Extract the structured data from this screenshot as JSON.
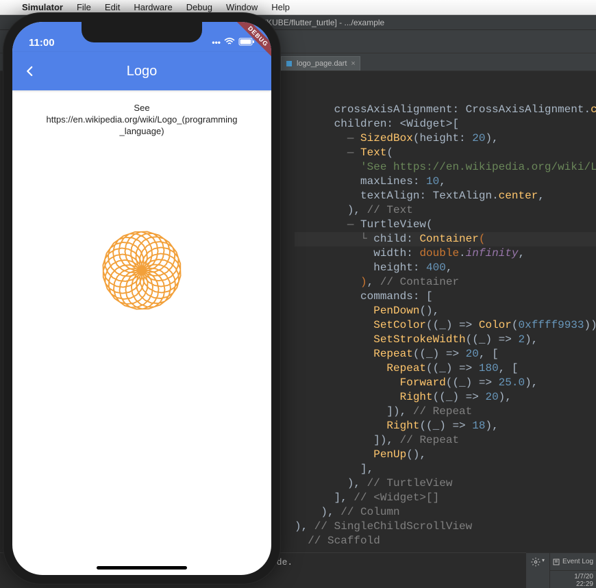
{
  "menubar": {
    "apple_icon": "",
    "items": [
      "Simulator",
      "File",
      "Edit",
      "Hardware",
      "Debug",
      "Window",
      "Help"
    ]
  },
  "ide": {
    "window_title": "flutter_turtle [~/KUBE/flutter_turtle] - .../example",
    "tab": {
      "label": "logo_page.dart"
    },
    "event_log_label": "Event Log",
    "timestamp_short": "1/7/20",
    "clock": "22:29",
    "console_tail": "ode.",
    "code_lines": [
      {
        "indent": 3,
        "tokens": [
          [
            "cls",
            "crossAxisAlignment"
          ],
          [
            "pun",
            ": "
          ],
          [
            "cls",
            "CrossAxisAlignment"
          ],
          [
            "pun",
            "."
          ],
          [
            "ylw",
            "cen"
          ]
        ]
      },
      {
        "indent": 3,
        "tokens": [
          [
            "cls",
            "children"
          ],
          [
            "pun",
            ": <"
          ],
          [
            "cls",
            "Widget"
          ],
          [
            "pun",
            ">["
          ]
        ]
      },
      {
        "indent": 4,
        "guide": true,
        "tokens": [
          [
            "ylw",
            "SizedBox"
          ],
          [
            "pun",
            "("
          ],
          [
            "cls",
            "height"
          ],
          [
            "pun",
            ": "
          ],
          [
            "num",
            "20"
          ],
          [
            "pun",
            "),"
          ]
        ]
      },
      {
        "indent": 4,
        "guide": true,
        "tokens": [
          [
            "ylw",
            "Text"
          ],
          [
            "pun",
            "("
          ]
        ]
      },
      {
        "indent": 5,
        "tokens": [
          [
            "str",
            "'See https://en.wikipedia.org/wiki/Logo"
          ]
        ]
      },
      {
        "indent": 5,
        "tokens": [
          [
            "cls",
            "maxLines"
          ],
          [
            "pun",
            ": "
          ],
          [
            "num",
            "10"
          ],
          [
            "pun",
            ","
          ]
        ]
      },
      {
        "indent": 5,
        "tokens": [
          [
            "cls",
            "textAlign"
          ],
          [
            "pun",
            ": "
          ],
          [
            "cls",
            "TextAlign"
          ],
          [
            "pun",
            "."
          ],
          [
            "ylw",
            "center"
          ],
          [
            "pun",
            ","
          ]
        ]
      },
      {
        "indent": 4,
        "tokens": [
          [
            "pun",
            "),"
          ],
          [
            "cmt",
            " // Text"
          ]
        ]
      },
      {
        "indent": 4,
        "guide": true,
        "tokens": [
          [
            "cls",
            "TurtleView"
          ],
          [
            "pun",
            "("
          ]
        ]
      },
      {
        "indent": 5,
        "hl": true,
        "guide2": true,
        "tokens": [
          [
            "cls",
            "child"
          ],
          [
            "pun",
            ": "
          ],
          [
            "ylw",
            "Container"
          ],
          [
            "kw",
            "("
          ]
        ]
      },
      {
        "indent": 6,
        "tokens": [
          [
            "cls",
            "width"
          ],
          [
            "pun",
            ": "
          ],
          [
            "kw",
            "double"
          ],
          [
            "pun",
            "."
          ],
          [
            "it",
            "infinity"
          ],
          [
            "pun",
            ","
          ]
        ]
      },
      {
        "indent": 6,
        "tokens": [
          [
            "cls",
            "height"
          ],
          [
            "pun",
            ": "
          ],
          [
            "num",
            "400"
          ],
          [
            "pun",
            ","
          ]
        ]
      },
      {
        "indent": 5,
        "tokens": [
          [
            "kw",
            ")"
          ],
          [
            "pun",
            ","
          ],
          [
            "cmt",
            " // Container"
          ]
        ]
      },
      {
        "indent": 5,
        "tokens": [
          [
            "cls",
            "commands"
          ],
          [
            "pun",
            ": ["
          ]
        ]
      },
      {
        "indent": 6,
        "tokens": [
          [
            "ylw",
            "PenDown"
          ],
          [
            "pun",
            "(),"
          ]
        ]
      },
      {
        "indent": 6,
        "tokens": [
          [
            "ylw",
            "SetColor"
          ],
          [
            "pun",
            "(("
          ],
          [
            "cls",
            "_"
          ],
          [
            "pun",
            ") => "
          ],
          [
            "ylw",
            "Color"
          ],
          [
            "pun",
            "("
          ],
          [
            "num",
            "0xffff9933"
          ],
          [
            "pun",
            ")),"
          ]
        ]
      },
      {
        "indent": 6,
        "tokens": [
          [
            "ylw",
            "SetStrokeWidth"
          ],
          [
            "pun",
            "(("
          ],
          [
            "cls",
            "_"
          ],
          [
            "pun",
            ") => "
          ],
          [
            "num",
            "2"
          ],
          [
            "pun",
            "),"
          ]
        ]
      },
      {
        "indent": 6,
        "tokens": [
          [
            "ylw",
            "Repeat"
          ],
          [
            "pun",
            "(("
          ],
          [
            "cls",
            "_"
          ],
          [
            "pun",
            ") => "
          ],
          [
            "num",
            "20"
          ],
          [
            "pun",
            ", ["
          ]
        ]
      },
      {
        "indent": 7,
        "tokens": [
          [
            "ylw",
            "Repeat"
          ],
          [
            "pun",
            "(("
          ],
          [
            "cls",
            "_"
          ],
          [
            "pun",
            ") => "
          ],
          [
            "num",
            "180"
          ],
          [
            "pun",
            ", ["
          ]
        ]
      },
      {
        "indent": 8,
        "tokens": [
          [
            "ylw",
            "Forward"
          ],
          [
            "pun",
            "(("
          ],
          [
            "cls",
            "_"
          ],
          [
            "pun",
            ") => "
          ],
          [
            "num",
            "25.0"
          ],
          [
            "pun",
            "),"
          ]
        ]
      },
      {
        "indent": 8,
        "tokens": [
          [
            "ylw",
            "Right"
          ],
          [
            "pun",
            "(("
          ],
          [
            "cls",
            "_"
          ],
          [
            "pun",
            ") => "
          ],
          [
            "num",
            "20"
          ],
          [
            "pun",
            "),"
          ]
        ]
      },
      {
        "indent": 7,
        "tokens": [
          [
            "pun",
            "]),"
          ],
          [
            "cmt",
            " // Repeat"
          ]
        ]
      },
      {
        "indent": 7,
        "tokens": [
          [
            "ylw",
            "Right"
          ],
          [
            "pun",
            "(("
          ],
          [
            "cls",
            "_"
          ],
          [
            "pun",
            ") => "
          ],
          [
            "num",
            "18"
          ],
          [
            "pun",
            "),"
          ]
        ]
      },
      {
        "indent": 6,
        "tokens": [
          [
            "pun",
            "]),"
          ],
          [
            "cmt",
            " // Repeat"
          ]
        ]
      },
      {
        "indent": 6,
        "tokens": [
          [
            "ylw",
            "PenUp"
          ],
          [
            "pun",
            "(),"
          ]
        ]
      },
      {
        "indent": 5,
        "tokens": [
          [
            "pun",
            "],"
          ]
        ]
      },
      {
        "indent": 4,
        "tokens": [
          [
            "pun",
            "),"
          ],
          [
            "cmt",
            " // TurtleView"
          ]
        ]
      },
      {
        "indent": 3,
        "tokens": [
          [
            "pun",
            "],"
          ],
          [
            "cmt",
            " // <Widget>[]"
          ]
        ]
      },
      {
        "indent": 2,
        "tokens": [
          [
            "pun",
            "),"
          ],
          [
            "cmt",
            " // Column"
          ]
        ]
      },
      {
        "indent": 0,
        "tokens": [
          [
            "pun",
            "),"
          ],
          [
            "cmt",
            " // SingleChildScrollView"
          ]
        ]
      },
      {
        "indent": 1,
        "tokens": [
          [
            "cmt",
            "// Scaffold"
          ]
        ]
      }
    ]
  },
  "simulator": {
    "status_time": "11:00",
    "debug_label": "DEBUG",
    "appbar_title": "Logo",
    "body_text_line1": "See",
    "body_text_line2": "https://en.wikipedia.org/wiki/Logo_(programming",
    "body_text_line3": "_language)",
    "turtle": {
      "color": "#f2a03a",
      "stroke": 2,
      "outer_repeat": 20,
      "inner_repeat": 180,
      "forward": 25.0,
      "right_inner": 20,
      "right_outer": 18
    }
  }
}
